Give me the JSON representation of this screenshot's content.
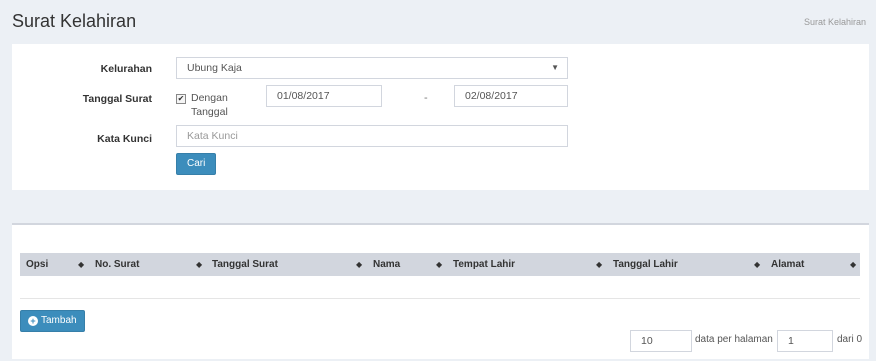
{
  "header": {
    "title": "Surat Kelahiran",
    "breadcrumb": "Surat Kelahiran"
  },
  "form": {
    "kelurahan_label": "Kelurahan",
    "kelurahan_value": "Ubung Kaja",
    "tanggal_label": "Tanggal Surat",
    "dengan_tanggal_line1": "Dengan",
    "dengan_tanggal_line2": "Tanggal",
    "dengan_tanggal_checked": true,
    "date_from": "01/08/2017",
    "date_separator": "-",
    "date_to": "02/08/2017",
    "kata_kunci_label": "Kata Kunci",
    "kata_kunci_placeholder": "Kata Kunci",
    "search_button": "Cari"
  },
  "table": {
    "columns": [
      "Opsi",
      "No. Surat",
      "Tanggal Surat",
      "Nama",
      "Tempat Lahir",
      "Tanggal Lahir",
      "Alamat"
    ]
  },
  "actions": {
    "add_button": "Tambah"
  },
  "pagination": {
    "per_page": "10",
    "per_page_label": "data per halaman",
    "page": "1",
    "of_label": "dari 0"
  },
  "colors": {
    "primary": "#3c8dbc",
    "background": "#ecf0f5",
    "table_header": "#d2d6de"
  }
}
